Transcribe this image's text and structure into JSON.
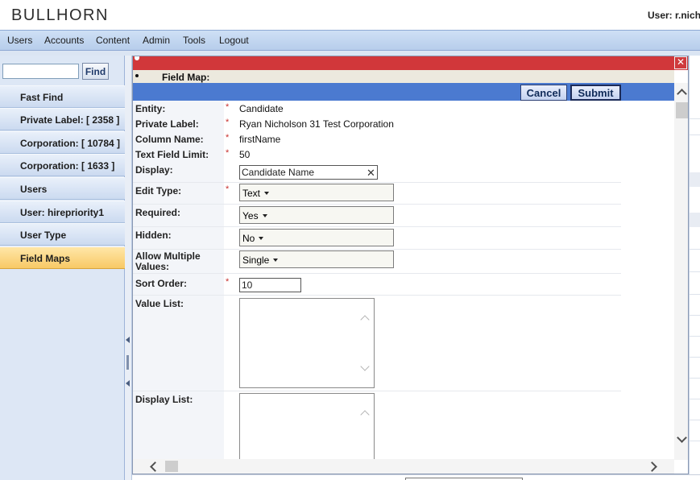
{
  "header": {
    "logo": "BULLHORN",
    "user_label": "User: r.nicholson"
  },
  "menu": [
    {
      "label": "Users"
    },
    {
      "label": "Accounts"
    },
    {
      "label": "Content"
    },
    {
      "label": "Admin"
    },
    {
      "label": "Tools"
    },
    {
      "label": "Logout"
    }
  ],
  "sidebar": {
    "search": {
      "value": "",
      "placeholder": ""
    },
    "find_label": "Find",
    "items": [
      {
        "label": "Fast Find"
      },
      {
        "label": "Private Label: [ 2358 ]"
      },
      {
        "label": "Corporation: [ 10784 ]"
      },
      {
        "label": "Corporation: [ 1633 ]"
      },
      {
        "label": "Users"
      },
      {
        "label": "User: hirepriority1"
      },
      {
        "label": "User Type"
      },
      {
        "label": "Field Maps"
      }
    ],
    "active_item": "Field Maps"
  },
  "modal": {
    "close_glyph": "✕",
    "header_title": "Field Map:",
    "cancel_label": "Cancel",
    "submit_label": "Submit",
    "fields": {
      "entity": {
        "label": "Entity:",
        "required": "*",
        "value": "Candidate"
      },
      "private_label": {
        "label": "Private Label:",
        "required": "*",
        "value": "Ryan Nicholson 31 Test Corporation"
      },
      "column_name": {
        "label": "Column Name:",
        "required": "*",
        "value": "firstName"
      },
      "text_field_limit": {
        "label": "Text Field Limit:",
        "required": "*",
        "value": "50"
      },
      "display": {
        "label": "Display:",
        "value": "Candidate Name",
        "clear_glyph": "✕"
      },
      "edit_type": {
        "label": "Edit Type:",
        "required": "*",
        "value": "Text"
      },
      "required_field": {
        "label": "Required:",
        "value": "Yes"
      },
      "hidden": {
        "label": "Hidden:",
        "value": "No"
      },
      "allow_multiple": {
        "label": "Allow Multiple Values:",
        "value": "Single"
      },
      "sort_order": {
        "label": "Sort Order:",
        "required": "*",
        "value": "10"
      },
      "value_list": {
        "label": "Value List:",
        "value": ""
      },
      "display_list": {
        "label": "Display List:",
        "value": ""
      }
    }
  },
  "colors": {
    "title_red": "#d1373a",
    "button_bar_blue": "#4b7ad0",
    "active_nav": "#f8c966",
    "required_star": "#c8312f"
  }
}
